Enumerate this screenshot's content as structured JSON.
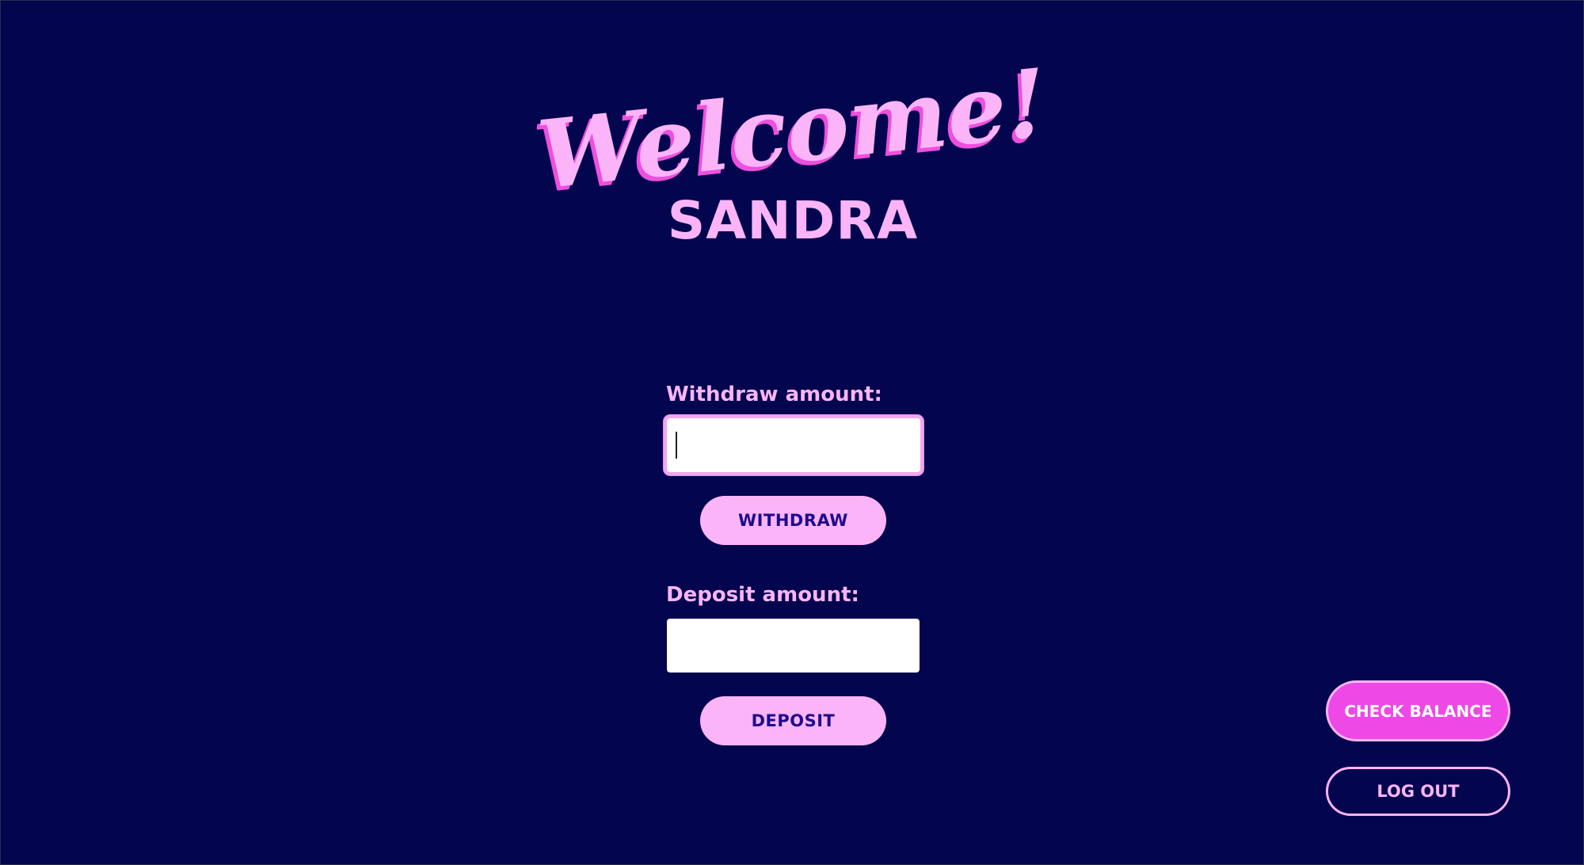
{
  "header": {
    "greeting": "Welcome!",
    "username": "SANDRA"
  },
  "withdraw": {
    "label": "Withdraw amount:",
    "value": "",
    "button_label": "WITHDRAW"
  },
  "deposit": {
    "label": "Deposit amount:",
    "value": "",
    "button_label": "DEPOSIT"
  },
  "actions": {
    "check_balance_label": "CHECK BALANCE",
    "logout_label": "LOG OUT"
  },
  "colors": {
    "background": "#03054e",
    "accent_pink": "#fbb4f7",
    "accent_magenta": "#ee48e6",
    "button_text": "#1e0a8c"
  }
}
